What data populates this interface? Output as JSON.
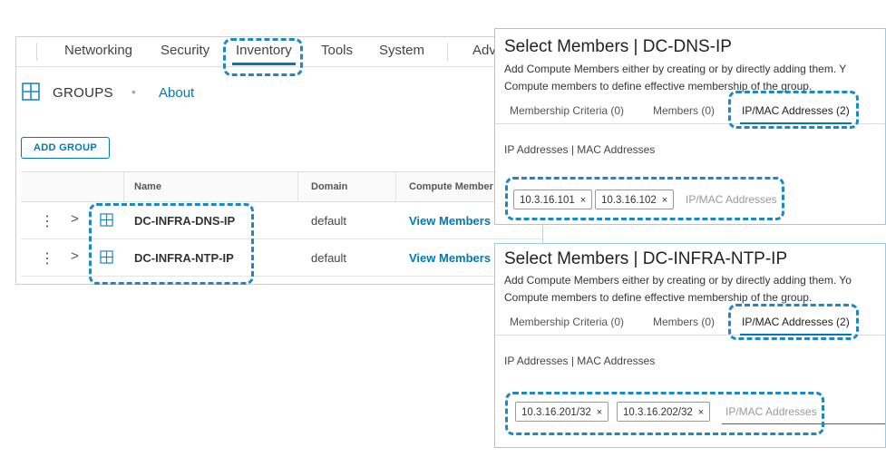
{
  "nav": {
    "items": [
      "Networking",
      "Security",
      "Inventory",
      "Tools",
      "System",
      "Adv"
    ],
    "active": "Inventory"
  },
  "header": {
    "title": "GROUPS",
    "separator": "•",
    "about": "About"
  },
  "toolbar": {
    "add_group": "ADD GROUP"
  },
  "table": {
    "columns": [
      "Name",
      "Domain",
      "Compute Member"
    ],
    "rows": [
      {
        "name": "DC-INFRA-DNS-IP",
        "domain": "default",
        "link": "View Members",
        "kebab": "⋮",
        "chevron": ">"
      },
      {
        "name": "DC-INFRA-NTP-IP",
        "domain": "default",
        "link": "View Members",
        "kebab": "⋮",
        "chevron": ">"
      }
    ]
  },
  "panel1": {
    "title": "Select Members | DC-DNS-IP",
    "desc1": "Add Compute Members either by creating or by directly adding them. Y",
    "desc2": "Compute members to define effective membership of the group.",
    "tabs": [
      "Membership Criteria (0)",
      "Members (0)",
      "IP/MAC Addresses (2)"
    ],
    "section": "IP Addresses | MAC Addresses",
    "tags": [
      "10.3.16.101",
      "10.3.16.102"
    ],
    "placeholder": "IP/MAC Addresses"
  },
  "panel2": {
    "title": "Select Members | DC-INFRA-NTP-IP",
    "desc1": "Add Compute Members either by creating or by directly adding them. Yo",
    "desc2": "Compute members to define effective membership of the group.",
    "tabs": [
      "Membership Criteria (0)",
      "Members (0)",
      "IP/MAC Addresses (2)"
    ],
    "section": "IP Addresses | MAC Addresses",
    "tags": [
      "10.3.16.201/32",
      "10.3.16.202/32"
    ],
    "placeholder": "IP/MAC Addresses"
  },
  "tag_remove": "×",
  "colors": {
    "accent": "#0079b8",
    "callout": "#1e88c7"
  }
}
